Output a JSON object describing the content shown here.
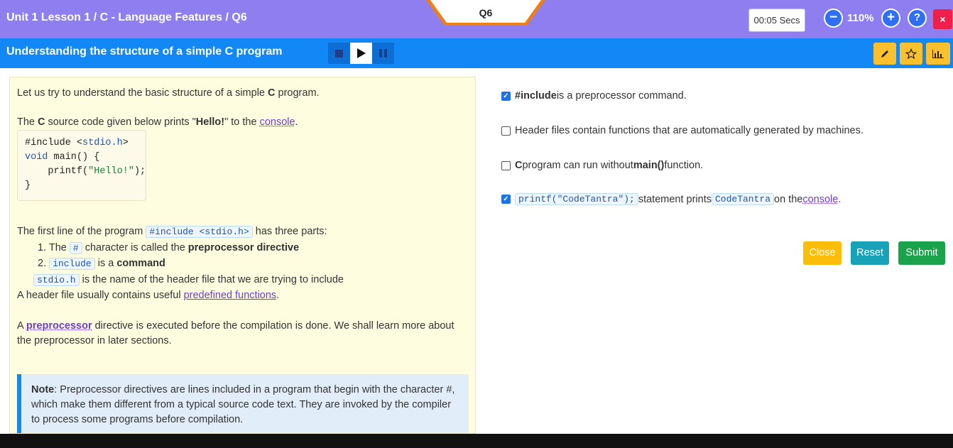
{
  "header": {
    "breadcrumb": "Unit 1 Lesson 1 / C - Language Features / Q6",
    "question_tab": "Q6",
    "timer": "00:05 Secs",
    "zoom": "110%",
    "zoom_out_icon": "minus-circle-icon",
    "zoom_in_icon": "plus-circle-icon",
    "help_icon": "question-circle-icon",
    "close_symbol": "×"
  },
  "subheader": {
    "title": "Understanding the structure of a simple C program",
    "media_icons": [
      "stop-icon",
      "play-icon",
      "pause-icon"
    ],
    "tool_icons": [
      "pencil-icon",
      "star-icon",
      "bar-chart-icon"
    ]
  },
  "lesson": {
    "intro_a": "Let us try to understand the basic structure of a simple ",
    "intro_c": "C",
    "intro_b": " program.",
    "p2_a": "The ",
    "p2_c": "C",
    "p2_b": " source code given below prints \"",
    "p2_hello": "Hello!",
    "p2_c2": "\" to the ",
    "p2_link": "console",
    "p2_end": ".",
    "code": {
      "l1_a": "#include <",
      "l1_b": "stdio.h",
      "l1_c": ">",
      "l2_a": "void",
      "l2_b": " main() {",
      "l3_a": "    printf(",
      "l3_b": "\"Hello!\"",
      "l3_c": ");",
      "l4": "}"
    },
    "first_line_a": "The first line of the program ",
    "first_line_code": "#include <stdio.h>",
    "first_line_b": " has three parts:",
    "item1_num": "1. The ",
    "item1_code": "#",
    "item1_a": " character is called the ",
    "item1_bold": "preprocessor directive",
    "item2_num": "2. ",
    "item2_code": "include",
    "item2_a": " is a ",
    "item2_bold": "command",
    "item3_code": "stdio.h",
    "item3_a": " is the name of the header file that we are trying to include",
    "header_a": "A header file usually contains useful ",
    "header_link": "predefined functions",
    "header_end": ".",
    "pre_a": "A ",
    "pre_link": "preprocessor",
    "pre_b": " directive is executed before the compilation is done. We shall learn more about",
    "pre_c": "the preprocessor in later sections.",
    "note_label": "Note",
    "note_text": ": Preprocessor directives are lines included in a program that begin with the character #, which make them different from a typical source code text. They are invoked by the compiler to process some programs before compilation."
  },
  "options": [
    {
      "checked": true,
      "bold": "#include",
      "text": " is a preprocessor command."
    },
    {
      "checked": false,
      "text": "Header files contain functions that are automatically generated by machines."
    },
    {
      "checked": false,
      "bold": "C",
      "text_a": " program can run without ",
      "bold2": "main()",
      "text_b": " function."
    },
    {
      "checked": true,
      "code1": "printf(\"CodeTantra\");",
      "text_a": " statement prints ",
      "code2": "CodeTantra",
      "text_b": " on the ",
      "link": "console",
      "end": "."
    }
  ],
  "buttons": {
    "close": "Close",
    "reset": "Reset",
    "submit": "Submit"
  },
  "colors": {
    "top_bar": "#8f7ef0",
    "sub_bar": "#1287f6",
    "close_btn": "#fbbd08",
    "reset_btn": "#17a2b8",
    "submit_btn": "#1aa34a"
  }
}
